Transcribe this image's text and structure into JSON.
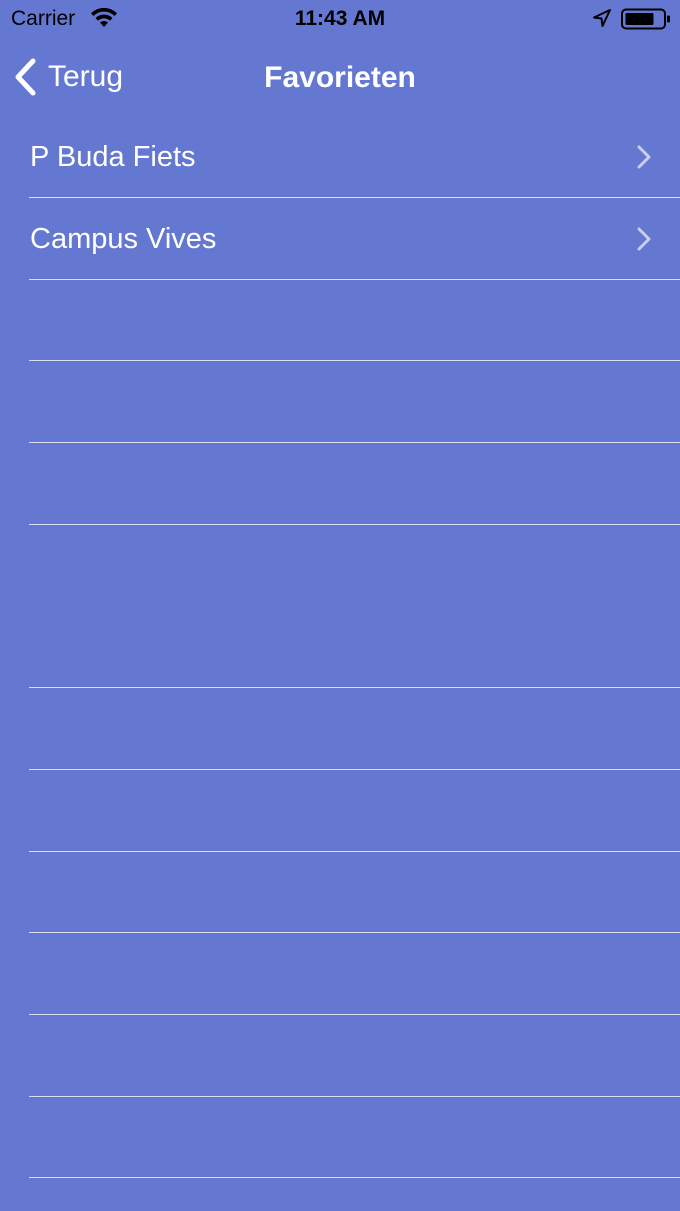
{
  "status_bar": {
    "carrier": "Carrier",
    "time": "11:43 AM",
    "icons": [
      "wifi-icon",
      "location-arrow-icon",
      "battery-icon"
    ]
  },
  "nav": {
    "back_label": "Terug",
    "title": "Favorieten"
  },
  "favorites": [
    {
      "label": "P Buda Fiets"
    },
    {
      "label": "Campus Vives"
    }
  ],
  "colors": {
    "background": "#6478D2",
    "text": "#FFFFFF",
    "separator": "#C9D0F0",
    "status_text": "#000000"
  }
}
